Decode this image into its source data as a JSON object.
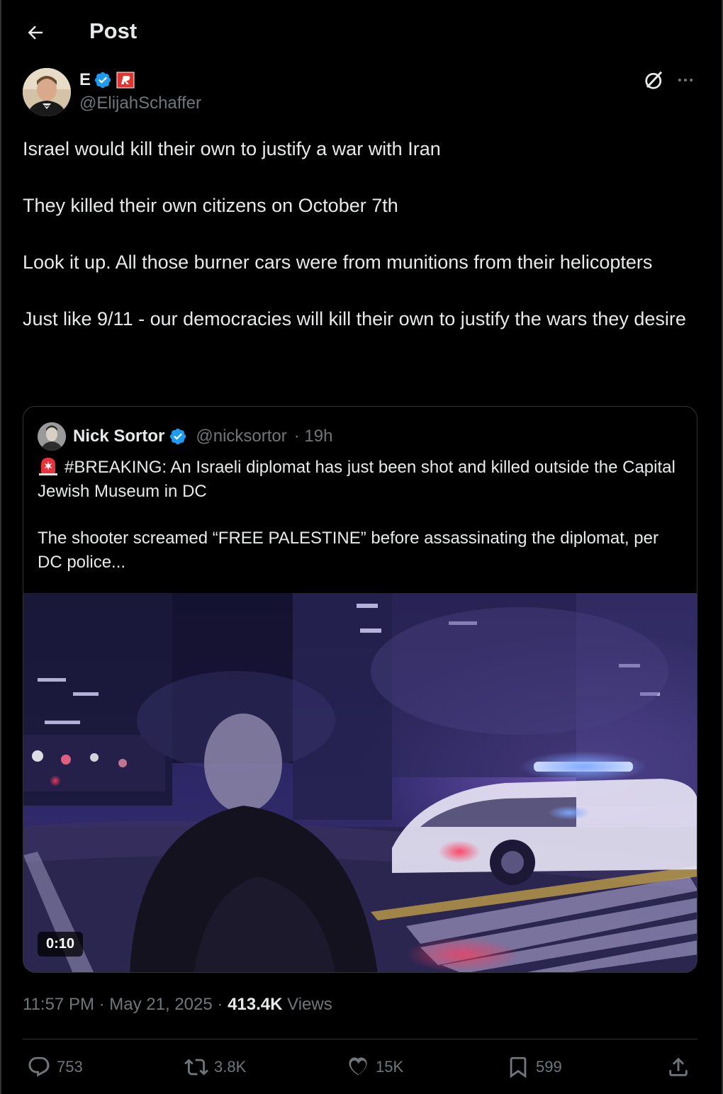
{
  "header": {
    "title": "Post"
  },
  "author": {
    "name": "E",
    "handle": "@ElijahSchaffer"
  },
  "post": {
    "paragraphs": [
      "Israel would kill their own to justify a war with Iran",
      "They killed their own citizens on October 7th",
      "Look it up. All those burner cars were from munitions from their helicopters",
      "Just like 9/11 - our democracies will kill their own to justify the wars they desire"
    ]
  },
  "quote": {
    "name": "Nick Sortor",
    "handle": "@nicksortor",
    "time": "· 19h",
    "text_1": "#BREAKING: An Israeli diplomat has just been shot and killed outside the Capital Jewish Museum in DC",
    "text_2": "The shooter screamed “FREE PALESTINE” before assassinating the diplomat, per DC police...",
    "video_duration": "0:10"
  },
  "meta": {
    "time": "11:57 PM",
    "date": "May 21, 2025",
    "views_count": "413.4K",
    "views_label": "Views"
  },
  "actions": {
    "replies": "753",
    "reposts": "3.8K",
    "likes": "15K",
    "bookmarks": "599"
  },
  "colors": {
    "background": "#000000",
    "text": "#e7e9ea",
    "muted": "#71767b",
    "verified": "#1d9bf0",
    "border": "#2f3336"
  }
}
